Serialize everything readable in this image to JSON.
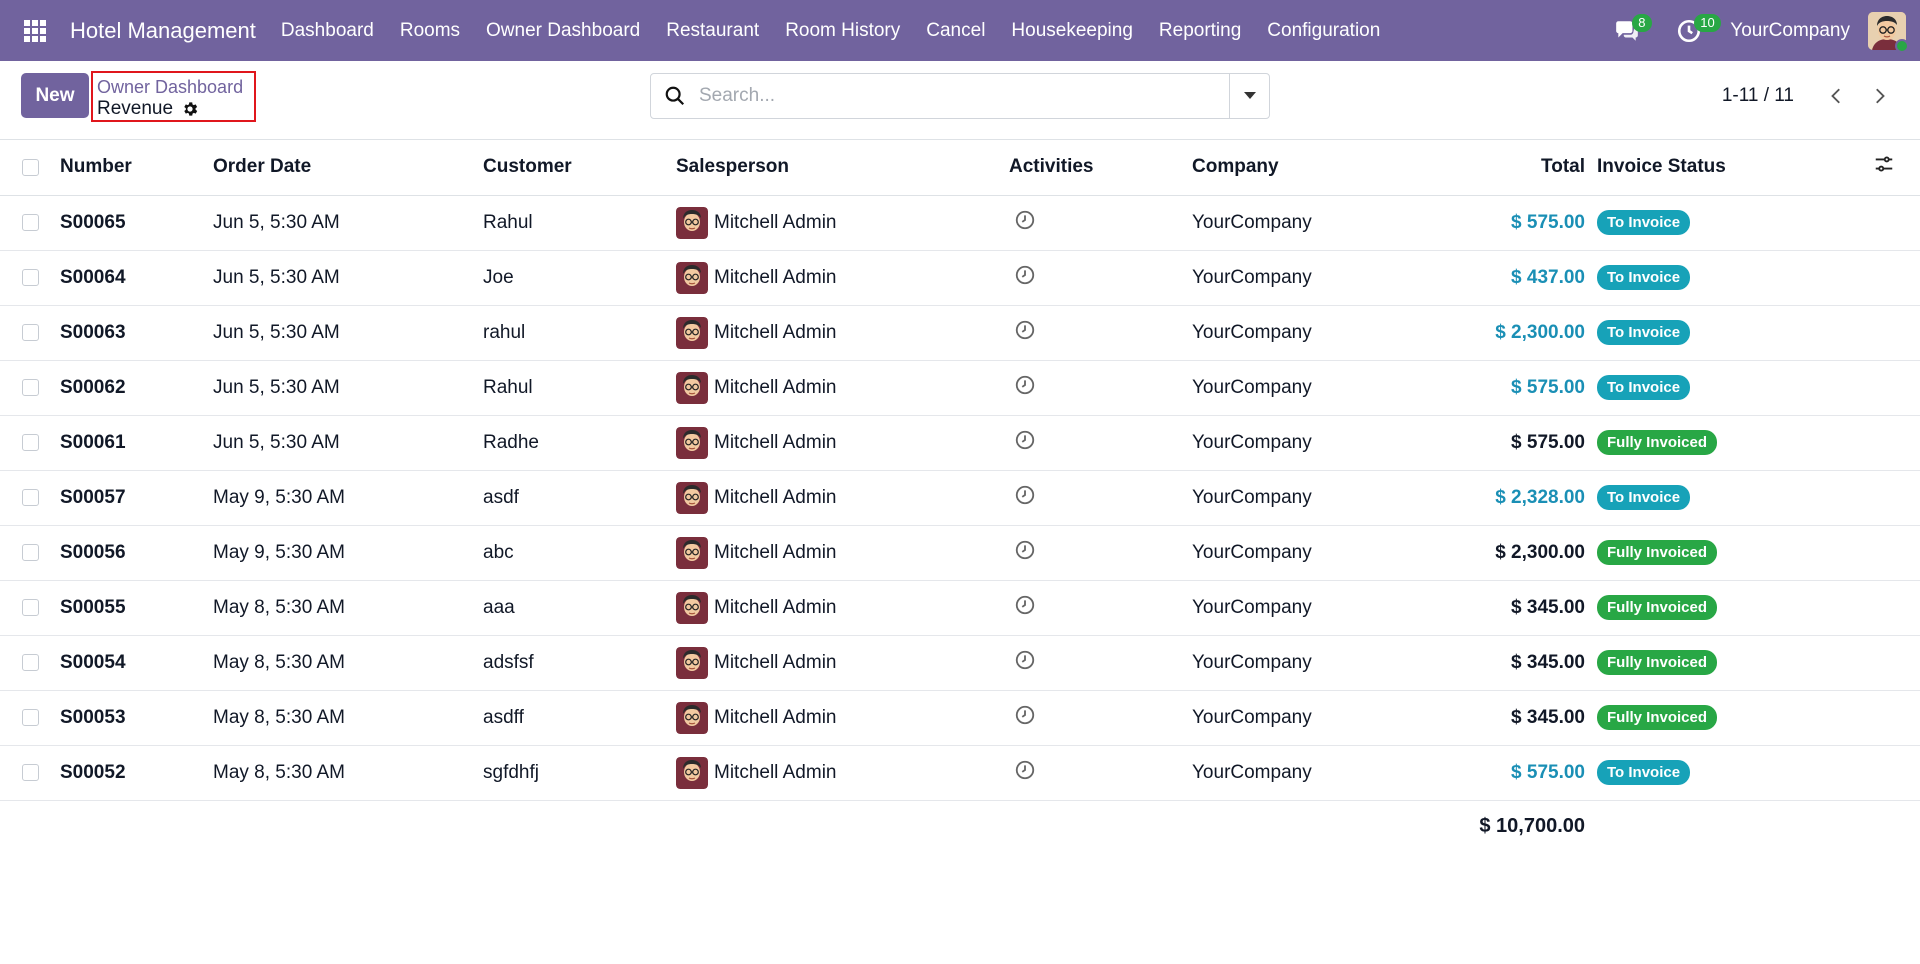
{
  "navbar": {
    "brand": "Hotel Management",
    "menu": [
      "Dashboard",
      "Rooms",
      "Owner Dashboard",
      "Restaurant",
      "Room History",
      "Cancel",
      "Housekeeping",
      "Reporting",
      "Configuration"
    ],
    "messages_count": "8",
    "activities_count": "10",
    "company": "YourCompany",
    "accent_color": "#71639e"
  },
  "control_panel": {
    "new_label": "New",
    "breadcrumb_parent": "Owner Dashboard",
    "breadcrumb_current": "Revenue",
    "search_placeholder": "Search...",
    "pager": "1-11 / 11"
  },
  "table": {
    "headers": {
      "number": "Number",
      "order_date": "Order Date",
      "customer": "Customer",
      "salesperson": "Salesperson",
      "activities": "Activities",
      "company": "Company",
      "total": "Total",
      "invoice_status": "Invoice Status"
    },
    "rows": [
      {
        "number": "S00065",
        "date": "Jun 5, 5:30 AM",
        "customer": "Rahul",
        "salesperson": "Mitchell Admin",
        "company": "YourCompany",
        "total": "$ 575.00",
        "highlight": true,
        "status": "To Invoice"
      },
      {
        "number": "S00064",
        "date": "Jun 5, 5:30 AM",
        "customer": "Joe",
        "salesperson": "Mitchell Admin",
        "company": "YourCompany",
        "total": "$ 437.00",
        "highlight": true,
        "status": "To Invoice"
      },
      {
        "number": "S00063",
        "date": "Jun 5, 5:30 AM",
        "customer": "rahul",
        "salesperson": "Mitchell Admin",
        "company": "YourCompany",
        "total": "$ 2,300.00",
        "highlight": true,
        "status": "To Invoice"
      },
      {
        "number": "S00062",
        "date": "Jun 5, 5:30 AM",
        "customer": "Rahul",
        "salesperson": "Mitchell Admin",
        "company": "YourCompany",
        "total": "$ 575.00",
        "highlight": true,
        "status": "To Invoice"
      },
      {
        "number": "S00061",
        "date": "Jun 5, 5:30 AM",
        "customer": "Radhe",
        "salesperson": "Mitchell Admin",
        "company": "YourCompany",
        "total": "$ 575.00",
        "highlight": false,
        "status": "Fully Invoiced"
      },
      {
        "number": "S00057",
        "date": "May 9, 5:30 AM",
        "customer": "asdf",
        "salesperson": "Mitchell Admin",
        "company": "YourCompany",
        "total": "$ 2,328.00",
        "highlight": true,
        "status": "To Invoice"
      },
      {
        "number": "S00056",
        "date": "May 9, 5:30 AM",
        "customer": "abc",
        "salesperson": "Mitchell Admin",
        "company": "YourCompany",
        "total": "$ 2,300.00",
        "highlight": false,
        "status": "Fully Invoiced"
      },
      {
        "number": "S00055",
        "date": "May 8, 5:30 AM",
        "customer": "aaa",
        "salesperson": "Mitchell Admin",
        "company": "YourCompany",
        "total": "$ 345.00",
        "highlight": false,
        "status": "Fully Invoiced"
      },
      {
        "number": "S00054",
        "date": "May 8, 5:30 AM",
        "customer": "adsfsf",
        "salesperson": "Mitchell Admin",
        "company": "YourCompany",
        "total": "$ 345.00",
        "highlight": false,
        "status": "Fully Invoiced"
      },
      {
        "number": "S00053",
        "date": "May 8, 5:30 AM",
        "customer": "asdff",
        "salesperson": "Mitchell Admin",
        "company": "YourCompany",
        "total": "$ 345.00",
        "highlight": false,
        "status": "Fully Invoiced"
      },
      {
        "number": "S00052",
        "date": "May 8, 5:30 AM",
        "customer": "sgfdhfj",
        "salesperson": "Mitchell Admin",
        "company": "YourCompany",
        "total": "$ 575.00",
        "highlight": true,
        "status": "To Invoice"
      }
    ],
    "grand_total": "$ 10,700.00"
  },
  "colors": {
    "link_total": "#1a8fb5",
    "status_to_invoice": "#17a2b8",
    "status_fully_invoiced": "#28a745",
    "breadcrumb_highlight": "#e0161c"
  }
}
